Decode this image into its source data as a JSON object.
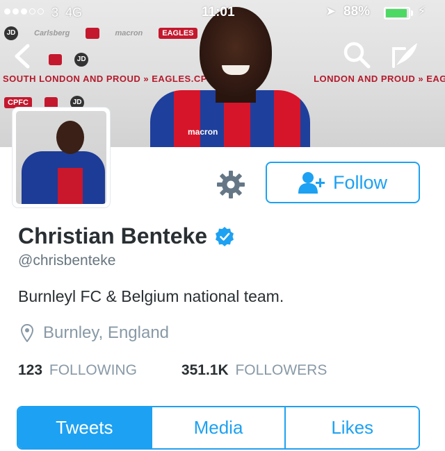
{
  "status_bar": {
    "carrier": "3",
    "network": "4G",
    "time": "11:01",
    "battery_percent": "88%",
    "battery_level": 0.88
  },
  "banner": {
    "slogan_left": "SOUTH LONDON AND PROUD »",
    "slogan_site": "EAGLES.CPFC.CO.UK",
    "slogan_right": "LONDON AND PROUD » EAGLES",
    "sponsor_1": "Carlsberg",
    "sponsor_2": "macron",
    "sponsor_3": "EAGLES",
    "sponsor_4": "CPFC",
    "shirt_sponsor": "macron"
  },
  "profile": {
    "name": "Christian Benteke",
    "handle": "@chrisbenteke",
    "bio": "Burnleyl FC & Belgium national team.",
    "location": "Burnley, England",
    "following_count": "123",
    "following_label": "FOLLOWING",
    "followers_count": "351.1K",
    "followers_label": "FOLLOWERS"
  },
  "actions": {
    "follow_label": "Follow"
  },
  "tabs": [
    {
      "label": "Tweets",
      "active": true
    },
    {
      "label": "Media",
      "active": false
    },
    {
      "label": "Likes",
      "active": false
    }
  ],
  "colors": {
    "accent": "#1da1f2",
    "text_primary": "#292f33",
    "text_secondary": "#8899a6",
    "battery_green": "#4cd964"
  }
}
